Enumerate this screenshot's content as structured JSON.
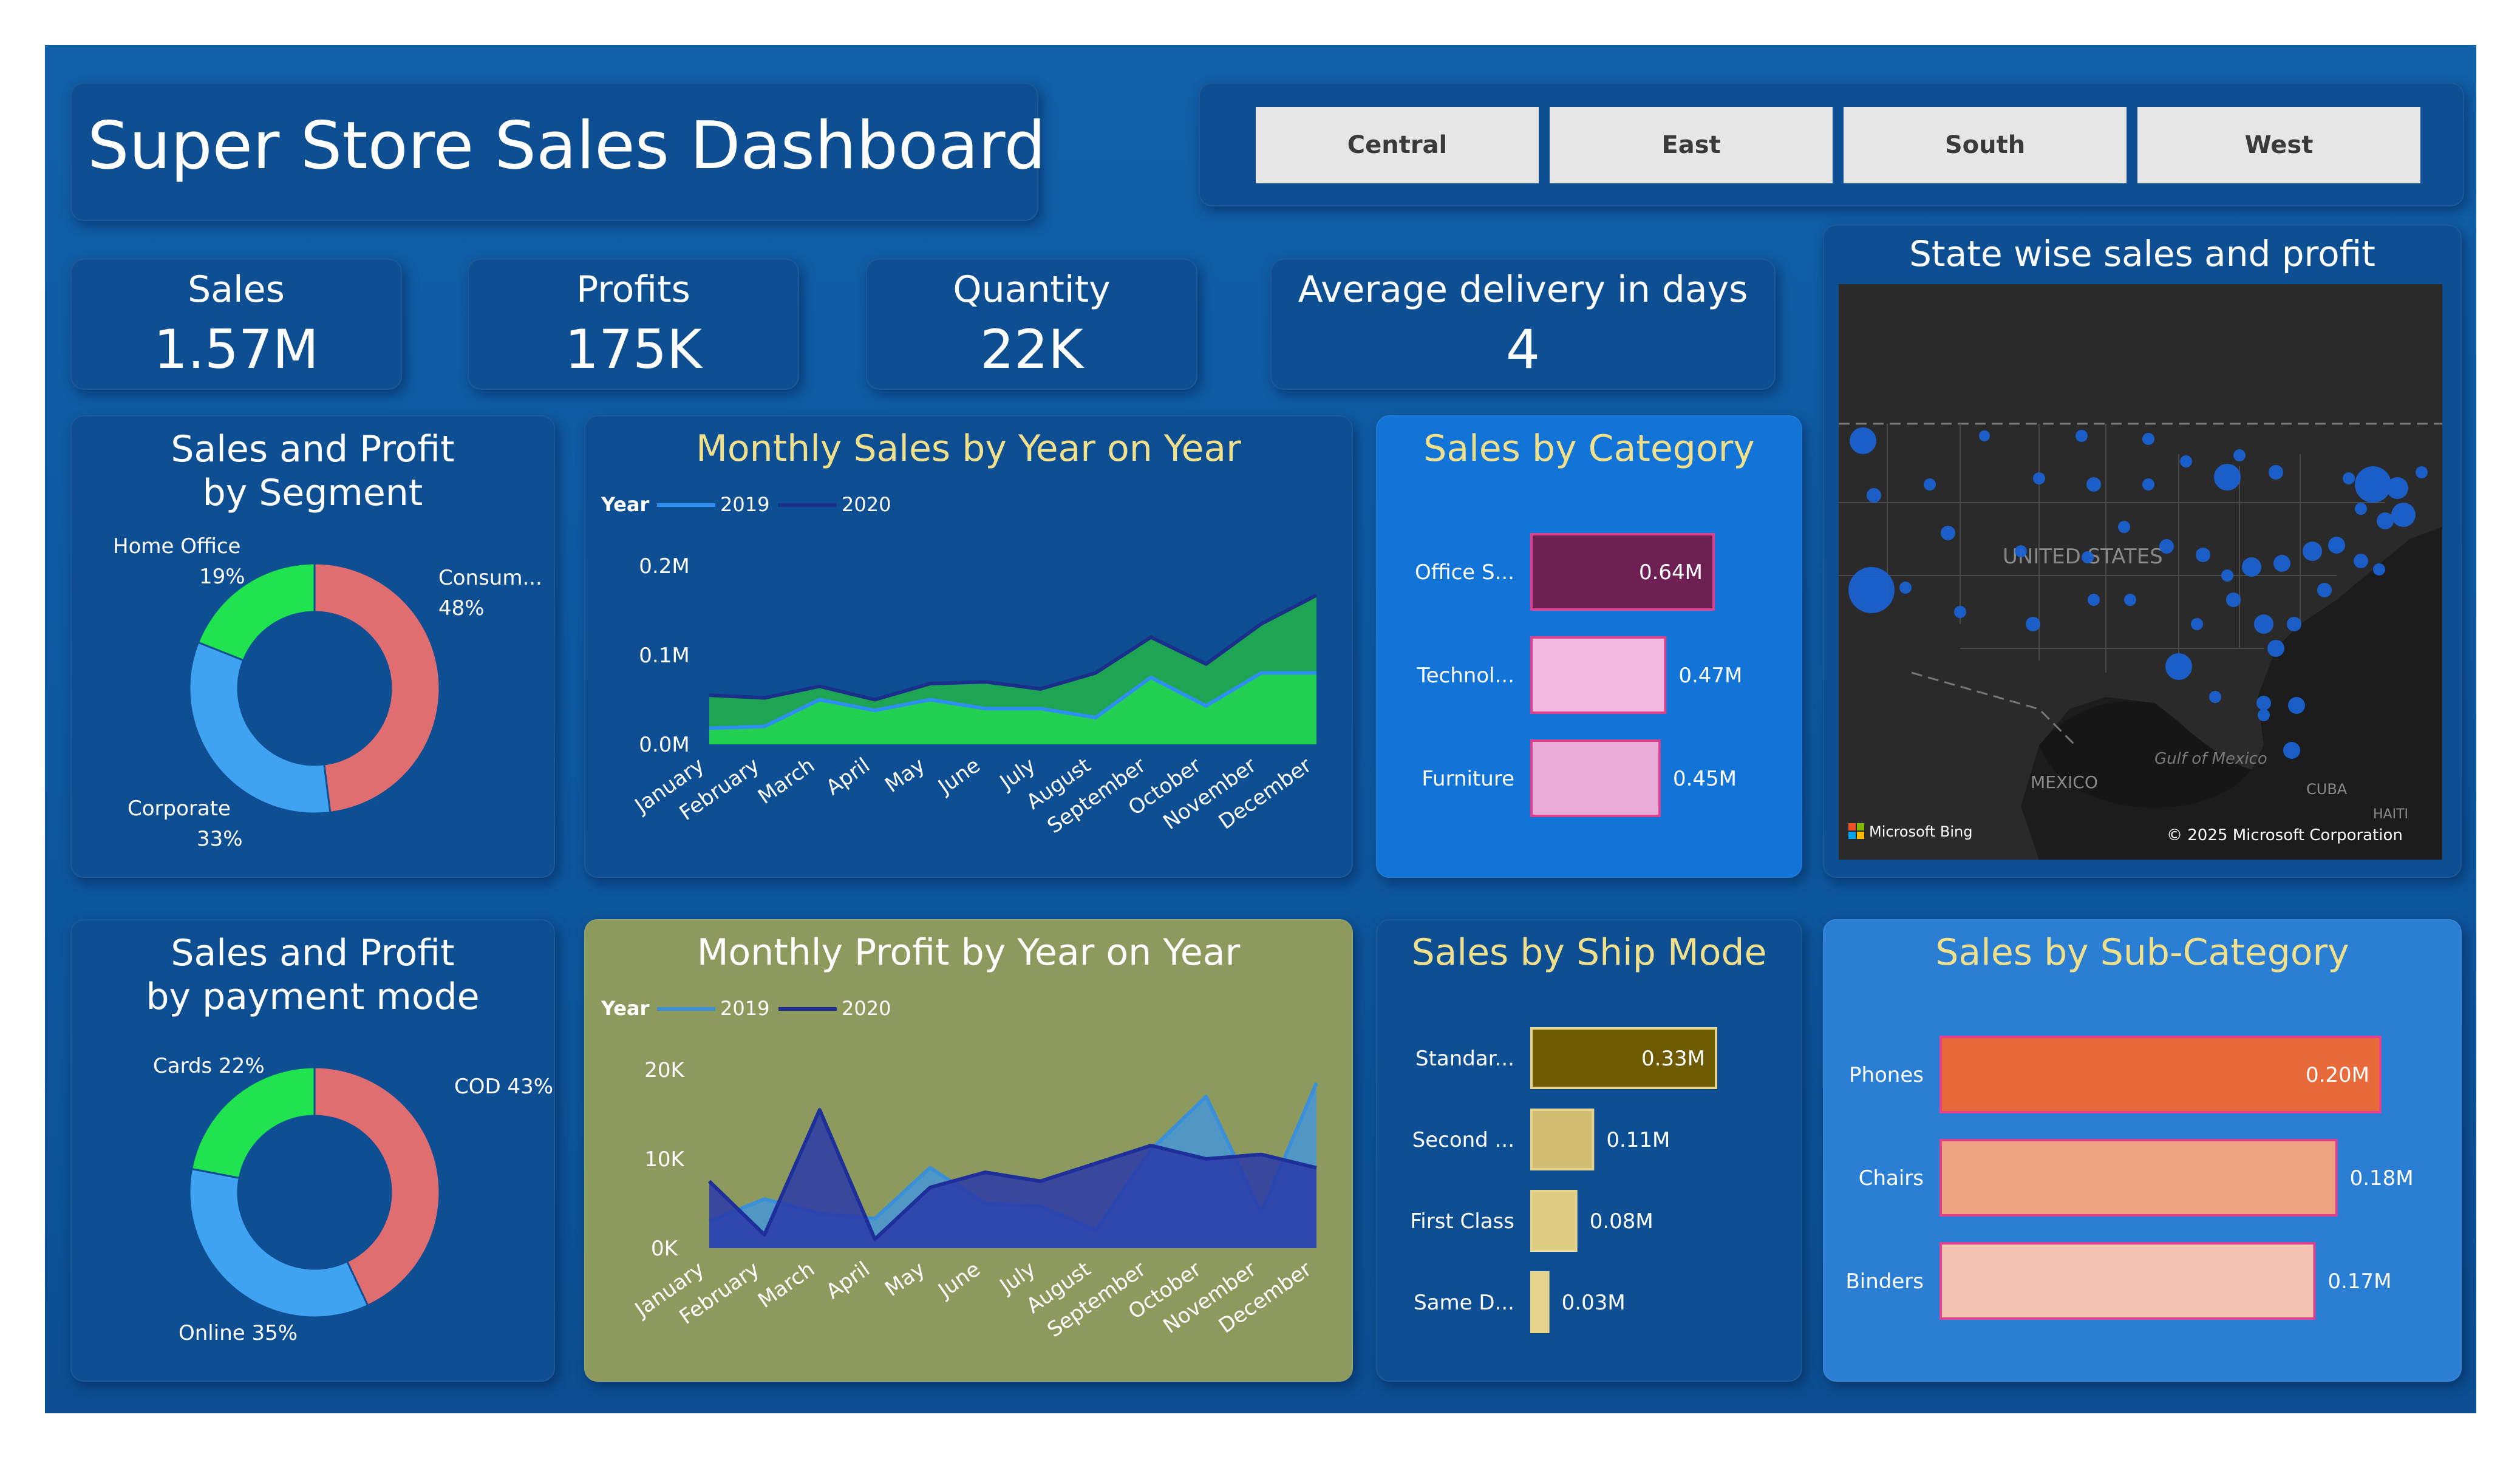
{
  "title": "Super Store Sales Dashboard",
  "regions": [
    "Central",
    "East",
    "South",
    "West"
  ],
  "kpis": {
    "sales_label": "Sales",
    "sales_value": "1.57M",
    "profits_label": "Profits",
    "profits_value": "175K",
    "quantity_label": "Quantity",
    "quantity_value": "22K",
    "delivery_label": "Average delivery in days",
    "delivery_value": "4"
  },
  "segment": {
    "title": "Sales and Profit by Segment",
    "slices": [
      {
        "name": "Consum...",
        "pct_label": "48%",
        "value": 48,
        "color": "#e06d70"
      },
      {
        "name": "Corporate",
        "pct_label": "33%",
        "value": 33,
        "color": "#40a3f2"
      },
      {
        "name": "Home Office",
        "pct_label": "19%",
        "value": 19,
        "color": "#1fe34f"
      }
    ]
  },
  "payment": {
    "title": "Sales and Profit by payment mode",
    "slices": [
      {
        "label": "COD 43%",
        "value": 43,
        "color": "#e06d70"
      },
      {
        "label": "Online 35%",
        "value": 35,
        "color": "#40a3f2"
      },
      {
        "label": "Cards 22%",
        "value": 22,
        "color": "#1fe34f"
      }
    ]
  },
  "monthly_sales": {
    "title": "Monthly Sales by Year on Year",
    "legend_title": "Year",
    "series_names": [
      "2019",
      "2020"
    ],
    "y_ticks": [
      "0.2M",
      "0.1M",
      "0.0M"
    ]
  },
  "monthly_profit": {
    "title": "Monthly Profit by Year on Year",
    "legend_title": "Year",
    "series_names": [
      "2019",
      "2020"
    ],
    "y_ticks": [
      "20K",
      "10K",
      "0K"
    ]
  },
  "months": [
    "January",
    "February",
    "March",
    "April",
    "May",
    "June",
    "July",
    "August",
    "September",
    "October",
    "November",
    "December"
  ],
  "category": {
    "title": "Sales by Category",
    "bars": [
      {
        "label": "Office S...",
        "value_label": "0.64M",
        "value": 0.64,
        "color": "#6e1f54"
      },
      {
        "label": "Technol...",
        "value_label": "0.47M",
        "value": 0.47,
        "color": "#f1b8de"
      },
      {
        "label": "Furniture",
        "value_label": "0.45M",
        "value": 0.45,
        "color": "#e8acd6"
      }
    ]
  },
  "map": {
    "title": "State wise sales and profit",
    "country_label": "UNITED STATES",
    "mexico_label": "MEXICO",
    "gulf_label": "Gulf of Mexico",
    "cuba_label": "CUBA",
    "haiti_label": "HAITI",
    "bing_label": "Microsoft Bing",
    "copyright": "© 2025 Microsoft Corporation"
  },
  "ship_mode": {
    "title": "Sales by Ship Mode",
    "bars": [
      {
        "label": "Standar...",
        "value_label": "0.33M",
        "value": 0.33,
        "color": "#6e5a00"
      },
      {
        "label": "Second ...",
        "value_label": "0.11M",
        "value": 0.11,
        "color": "#d2be73"
      },
      {
        "label": "First Class",
        "value_label": "0.08M",
        "value": 0.08,
        "color": "#dccb80"
      },
      {
        "label": "Same D...",
        "value_label": "0.03M",
        "value": 0.03,
        "color": "#e6d48c"
      }
    ]
  },
  "sub_category": {
    "title": "Sales by Sub-Category",
    "bars": [
      {
        "label": "Phones",
        "value_label": "0.20M",
        "value": 0.2,
        "color": "#e8693a"
      },
      {
        "label": "Chairs",
        "value_label": "0.18M",
        "value": 0.18,
        "color": "#eea482"
      },
      {
        "label": "Binders",
        "value_label": "0.17M",
        "value": 0.17,
        "color": "#f4c2b0"
      }
    ]
  },
  "chart_data": [
    {
      "type": "area",
      "title": "Monthly Sales by Year on Year",
      "x": [
        "January",
        "February",
        "March",
        "April",
        "May",
        "June",
        "July",
        "August",
        "September",
        "October",
        "November",
        "December"
      ],
      "ylim": [
        0,
        0.2
      ],
      "series": [
        {
          "name": "2019",
          "color": "#2f8ff0",
          "values": [
            0.018,
            0.02,
            0.05,
            0.038,
            0.05,
            0.04,
            0.04,
            0.03,
            0.075,
            0.043,
            0.08,
            0.08
          ]
        },
        {
          "name": "2020",
          "color": "#1a2f8a",
          "values": [
            0.055,
            0.052,
            0.065,
            0.05,
            0.068,
            0.07,
            0.062,
            0.08,
            0.12,
            0.09,
            0.135,
            0.167
          ]
        }
      ]
    },
    {
      "type": "area",
      "title": "Monthly Profit by Year on Year",
      "x": [
        "January",
        "February",
        "March",
        "April",
        "May",
        "June",
        "July",
        "August",
        "September",
        "October",
        "November",
        "December"
      ],
      "ylim": [
        0,
        20000
      ],
      "series": [
        {
          "name": "2019",
          "color": "#3a8fd8",
          "values": [
            3000,
            5500,
            3900,
            3300,
            9000,
            5000,
            4700,
            2000,
            11000,
            17000,
            4000,
            18500
          ]
        },
        {
          "name": "2020",
          "color": "#1e2f9a",
          "values": [
            7500,
            1500,
            15500,
            1000,
            6800,
            8500,
            7500,
            9500,
            11500,
            10000,
            10500,
            9000
          ]
        }
      ]
    },
    {
      "type": "pie",
      "title": "Sales and Profit by Segment",
      "categories": [
        "Consum...",
        "Corporate",
        "Home Office"
      ],
      "values": [
        48,
        33,
        19
      ]
    },
    {
      "type": "pie",
      "title": "Sales and Profit by payment mode",
      "categories": [
        "COD",
        "Online",
        "Cards"
      ],
      "values": [
        43,
        35,
        22
      ]
    },
    {
      "type": "bar",
      "title": "Sales by Category",
      "categories": [
        "Office S...",
        "Technol...",
        "Furniture"
      ],
      "values": [
        0.64,
        0.47,
        0.45
      ]
    },
    {
      "type": "bar",
      "title": "Sales by Ship Mode",
      "categories": [
        "Standar...",
        "Second ...",
        "First Class",
        "Same D..."
      ],
      "values": [
        0.33,
        0.11,
        0.08,
        0.03
      ]
    },
    {
      "type": "bar",
      "title": "Sales by Sub-Category",
      "categories": [
        "Phones",
        "Chairs",
        "Binders"
      ],
      "values": [
        0.2,
        0.18,
        0.17
      ]
    }
  ]
}
